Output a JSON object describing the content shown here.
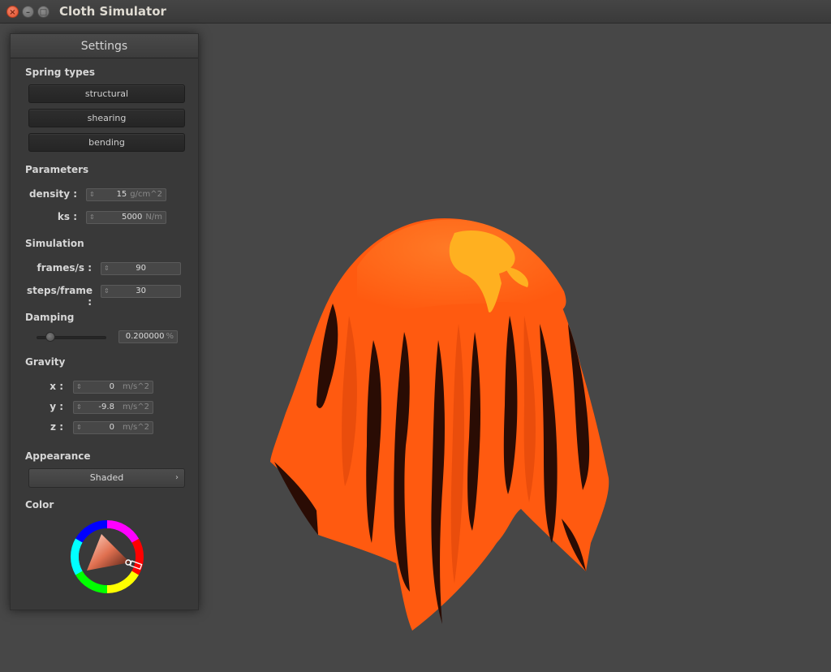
{
  "window": {
    "title": "Cloth Simulator"
  },
  "panel": {
    "header": "Settings",
    "spring_types": {
      "title": "Spring types",
      "buttons": [
        "structural",
        "shearing",
        "bending"
      ]
    },
    "parameters": {
      "title": "Parameters",
      "density": {
        "label": "density :",
        "value": "15",
        "unit": "g/cm^2"
      },
      "ks": {
        "label": "ks :",
        "value": "5000",
        "unit": "N/m"
      }
    },
    "simulation": {
      "title": "Simulation",
      "fps": {
        "label": "frames/s :",
        "value": "90"
      },
      "steps": {
        "label": "steps/frame :",
        "value": "30"
      }
    },
    "damping": {
      "title": "Damping",
      "value": "0.200000",
      "unit": "%",
      "slider_fraction": 0.2
    },
    "gravity": {
      "title": "Gravity",
      "x": {
        "label": "x :",
        "value": "0",
        "unit": "m/s^2"
      },
      "y": {
        "label": "y :",
        "value": "-9.8",
        "unit": "m/s^2"
      },
      "z": {
        "label": "z :",
        "value": "0",
        "unit": "m/s^2"
      }
    },
    "appearance": {
      "title": "Appearance",
      "selected": "Shaded"
    },
    "color": {
      "title": "Color",
      "selected_hex": "#ff5a10"
    }
  },
  "colors": {
    "cloth": "#ff5a10",
    "cloth_highlight": "#ffb020",
    "background": "#474747"
  },
  "icons": {
    "close": "close-icon",
    "minimize": "minimize-icon",
    "maximize": "maximize-icon",
    "combo": "chevron-right-icon"
  }
}
